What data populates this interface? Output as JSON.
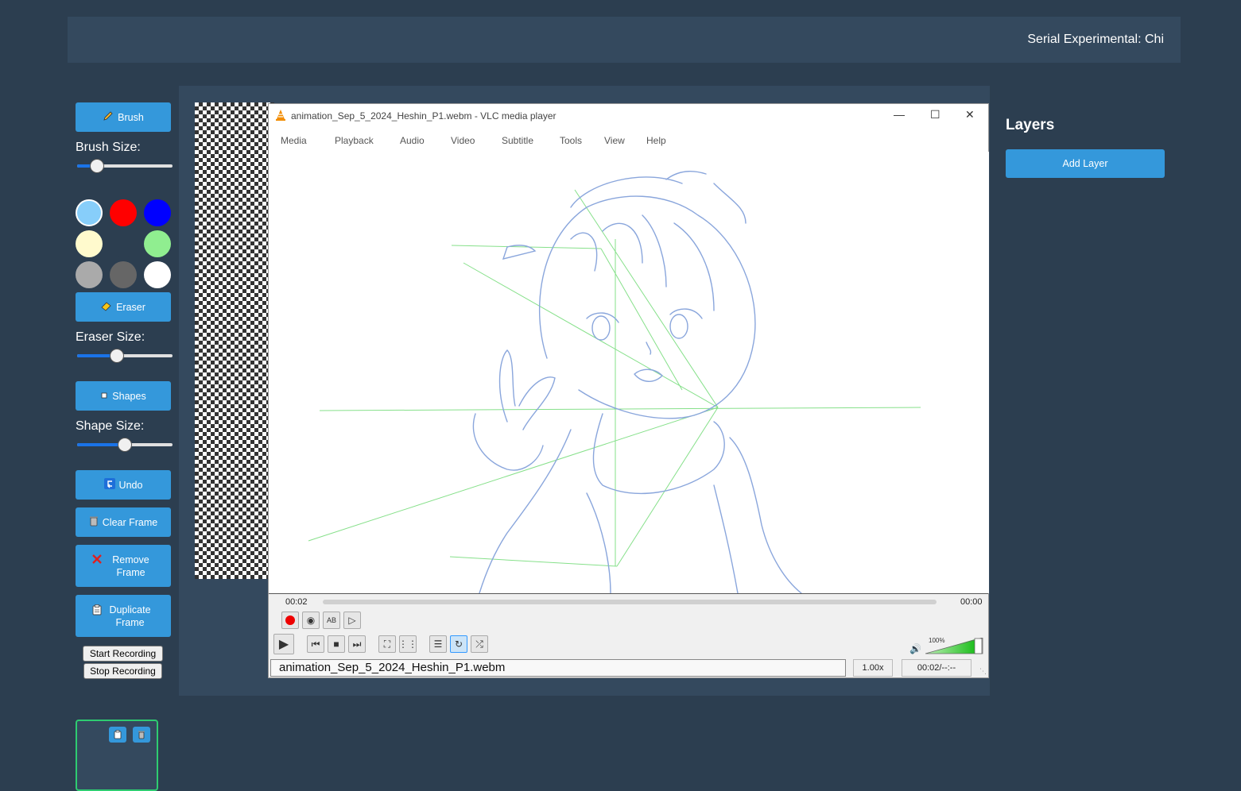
{
  "header": {
    "title": "Serial Experimental: Chi"
  },
  "tools": {
    "brush_label": "Brush",
    "brush_size_label": "Brush Size:",
    "brush_size_value": 0.15,
    "colors": [
      "#87cefa",
      "#ff0000",
      "#0000ff",
      "#fffacd",
      "#2c3e50",
      "#90ee90",
      "#aaaaaa",
      "#666666",
      "#ffffff"
    ],
    "selected_color": "#87cefa",
    "eraser_label": "Eraser",
    "eraser_size_label": "Eraser Size:",
    "eraser_size_value": 0.4,
    "shapes_label": "Shapes",
    "shape_size_label": "Shape Size:",
    "shape_size_value": 0.5,
    "undo_label": "Undo",
    "clear_frame_label": "Clear Frame",
    "remove_frame_label": "Remove Frame",
    "duplicate_frame_label": "Duplicate Frame",
    "start_recording_label": "Start Recording",
    "stop_recording_label": "Stop Recording"
  },
  "vlc": {
    "window_title": "animation_Sep_5_2024_Heshin_P1.webm - VLC media player",
    "menu": [
      "Media",
      "Playback",
      "Audio",
      "Video",
      "Subtitle",
      "Tools",
      "View",
      "Help"
    ],
    "elapsed": "00:02",
    "remaining": "00:00",
    "volume": "100%",
    "filename": "animation_Sep_5_2024_Heshin_P1.webm",
    "speed": "1.00x",
    "time_status": "00:02/--:--"
  },
  "layers": {
    "title": "Layers",
    "add_layer_label": "Add Layer"
  }
}
